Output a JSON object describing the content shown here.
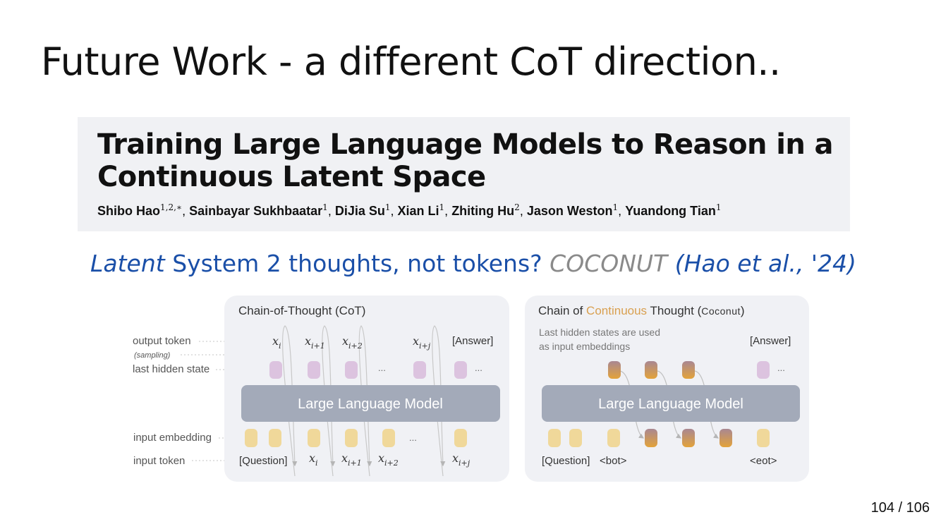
{
  "slide": {
    "title": "Future Work - a different CoT direction..",
    "page_number": "104 / 106"
  },
  "paper": {
    "title_line1": "Training Large Language Models to Reason in a",
    "title_line2": "Continuous Latent Space",
    "authors": [
      {
        "name": "Shibo Hao",
        "aff": "1,2,∗"
      },
      {
        "name": "Sainbayar Sukhbaatar",
        "aff": "1"
      },
      {
        "name": "DiJia Su",
        "aff": "1"
      },
      {
        "name": "Xian Li",
        "aff": "1"
      },
      {
        "name": "Zhiting Hu",
        "aff": "2"
      },
      {
        "name": "Jason Weston",
        "aff": "1"
      },
      {
        "name": "Yuandong Tian",
        "aff": "1"
      }
    ]
  },
  "subtitle": {
    "part1": "Latent",
    "part2": " System 2 thoughts, not tokens? ",
    "part3": "COCONUT",
    "part4": " (Hao et al., '24)"
  },
  "diagram": {
    "colors": {
      "panel_bg": "#f0f1f5",
      "llm_bar": "#a3aab9",
      "input_token": "#f0d89a",
      "hidden_state": "#dcc3df",
      "latent_top": "#a98792",
      "latent_bottom": "#e3a33a",
      "accent_continuous": "#d9a050"
    },
    "row_labels": {
      "output_token": "output token",
      "sampling": "(sampling)",
      "last_hidden_state": "last hidden state",
      "input_embedding": "input embedding",
      "input_token": "input token"
    },
    "cot": {
      "title": "Chain-of-Thought (CoT)",
      "llm_label": "Large Language Model",
      "answer": "[Answer]",
      "question": "[Question]",
      "ellipsis": "...",
      "var": "x",
      "subscripts": [
        "i",
        "i+1",
        "i+2",
        "i+j"
      ]
    },
    "coconut": {
      "title_pre": "Chain of ",
      "title_accent": "Continuous",
      "title_post": " Thought (",
      "title_name": "Coconut",
      "title_close": ")",
      "note_line1": "Last hidden states are used",
      "note_line2": "as input embeddings",
      "llm_label": "Large Language Model",
      "answer": "[Answer]",
      "question": "[Question]",
      "bot": "<bot>",
      "eot": "<eot>",
      "ellipsis": "..."
    }
  }
}
